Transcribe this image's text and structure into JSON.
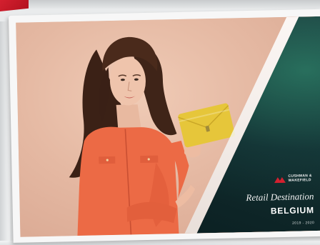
{
  "brochure": {
    "logo_text_line1": "CUSHMAN &",
    "logo_text_line2": "WAKEFIELD",
    "subtitle": "Retail Destination",
    "title": "BELGIUM",
    "years": "2019 - 2020"
  },
  "colors": {
    "brand_red": "#d4202f",
    "panel_dark": "#0d2426",
    "backdrop": "#e3b9a4",
    "jacket": "#ec6a45",
    "clutch": "#e6c63a"
  },
  "icons": {
    "logo": "cushman-wakefield-logo-icon",
    "photo": "woman-with-yellow-clutch-photo"
  }
}
